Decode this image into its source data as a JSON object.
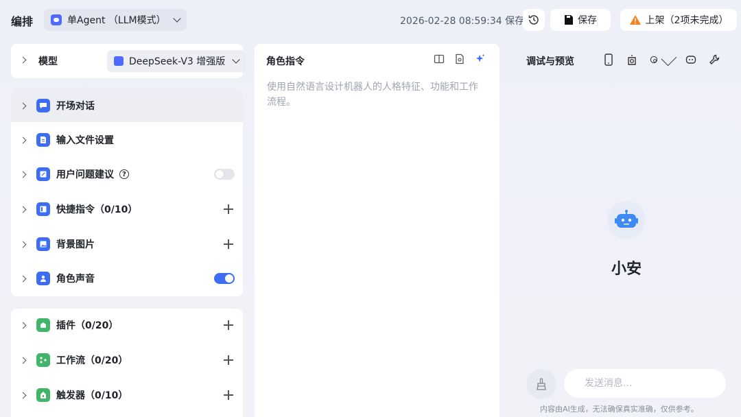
{
  "header": {
    "title": "编排",
    "mode_select": "单Agent （LLM模式）",
    "save_time": "2026-02-28 08:59:34 保存",
    "save_label": "保存",
    "publish_label": "上架（2项未完成）"
  },
  "model": {
    "label": "模型",
    "value": "DeepSeek-V3 增强版"
  },
  "skills": [
    {
      "label": "开场对话"
    },
    {
      "label": "输入文件设置"
    },
    {
      "label": "用户问题建议",
      "toggle": false
    },
    {
      "label": "快捷指令（0/10）"
    },
    {
      "label": "背景图片"
    },
    {
      "label": "角色声音",
      "toggle": true
    }
  ],
  "tools": [
    {
      "label": "插件（0/20）"
    },
    {
      "label": "工作流（0/20）"
    },
    {
      "label": "触发器（0/10）"
    }
  ],
  "role": {
    "title": "角色指令",
    "placeholder": "使用自然语言设计机器人的人格特征、功能和工作流程。"
  },
  "preview": {
    "title": "调试与预览",
    "bot_name": "小安",
    "input_placeholder": "发送消息...",
    "disclaimer": "内容由AI生成，无法确保真实准确，仅供参考。"
  },
  "colors": {
    "accent": "#3d6df2",
    "tool_icon": "#41b66a",
    "warning": "#f5801f"
  }
}
